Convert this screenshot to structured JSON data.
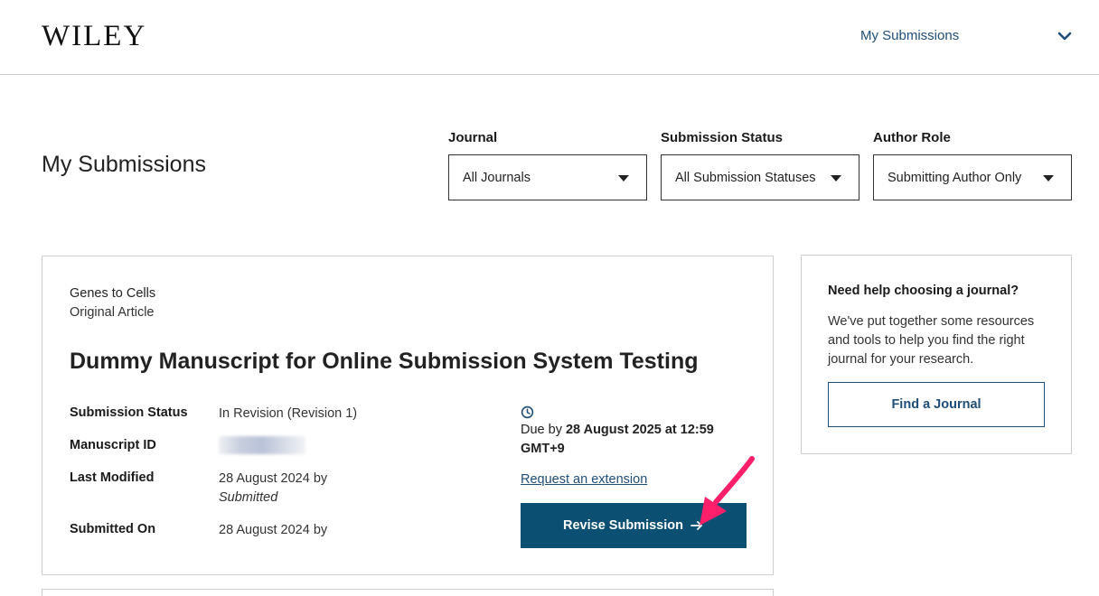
{
  "header": {
    "logo": "WILEY",
    "nav_label": "My Submissions",
    "nav_icon": "chevron-down-icon"
  },
  "page": {
    "title": "My Submissions"
  },
  "filters": {
    "journal": {
      "label": "Journal",
      "value": "All Journals"
    },
    "status": {
      "label": "Submission Status",
      "value": "All Submission Statuses"
    },
    "role": {
      "label": "Author Role",
      "value": "Submitting Author Only"
    }
  },
  "submission": {
    "journal": "Genes to Cells",
    "article_type": "Original Article",
    "title": "Dummy Manuscript for Online Submission System Testing",
    "fields": {
      "status_label": "Submission Status",
      "status_value": "In Revision (Revision 1)",
      "id_label": "Manuscript ID",
      "modified_label": "Last Modified",
      "modified_value": "28 August 2024 by",
      "modified_sub": "Submitted",
      "submitted_label": "Submitted On",
      "submitted_value": "28 August 2024 by"
    },
    "due": {
      "prefix": "Due by ",
      "date": "28 August 2025 at 12:59 GMT+9"
    },
    "extension_link": "Request an extension",
    "revise_button": "Revise Submission"
  },
  "help": {
    "title": "Need help choosing a journal?",
    "body": "We've put together some resources and tools to help you find the right journal for your research.",
    "button": "Find a Journal"
  },
  "colors": {
    "primary": "#0b4f73",
    "link": "#1f4e79",
    "annotation": "#ff1f6b"
  }
}
